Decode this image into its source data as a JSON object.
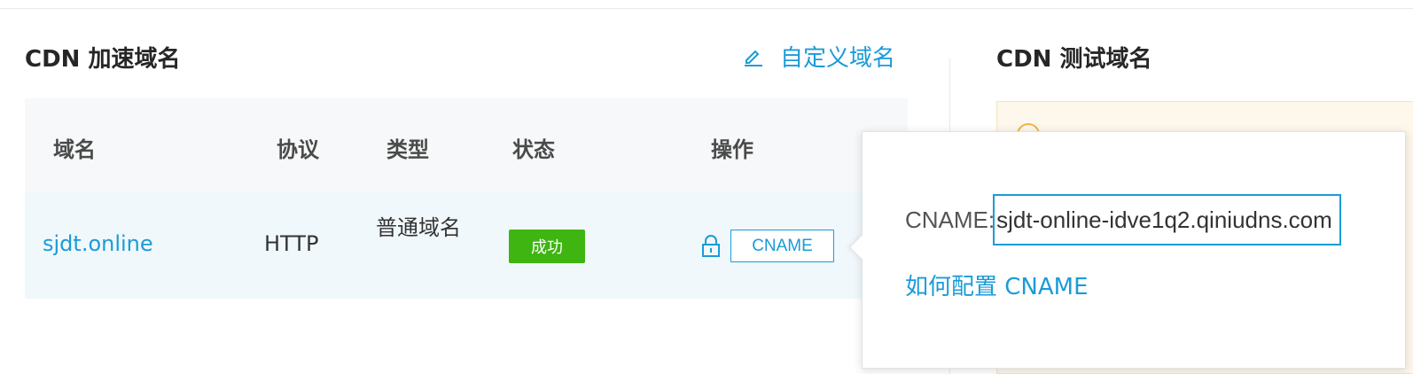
{
  "cdn_section": {
    "title": "CDN 加速域名",
    "custom_domain_label": "自定义域名"
  },
  "table": {
    "headers": [
      "域名",
      "协议",
      "类型",
      "状态",
      "操作"
    ],
    "rows": [
      {
        "domain": "sjdt.online",
        "protocol": "HTTP",
        "type": "普通域名",
        "status": "成功",
        "action_button": "CNAME"
      }
    ]
  },
  "test_section": {
    "title": "CDN 测试域名"
  },
  "popover": {
    "cname_label": "CNAME:",
    "cname_value": "sjdt-online-idve1q2.qiniudns.com",
    "howto_link": "如何配置 CNAME"
  },
  "colors": {
    "accent": "#1b9bd8",
    "success": "#3eb511",
    "warning_bg": "#fdf7ec"
  },
  "icons": [
    "edit-icon",
    "lock-icon",
    "warning-icon"
  ]
}
